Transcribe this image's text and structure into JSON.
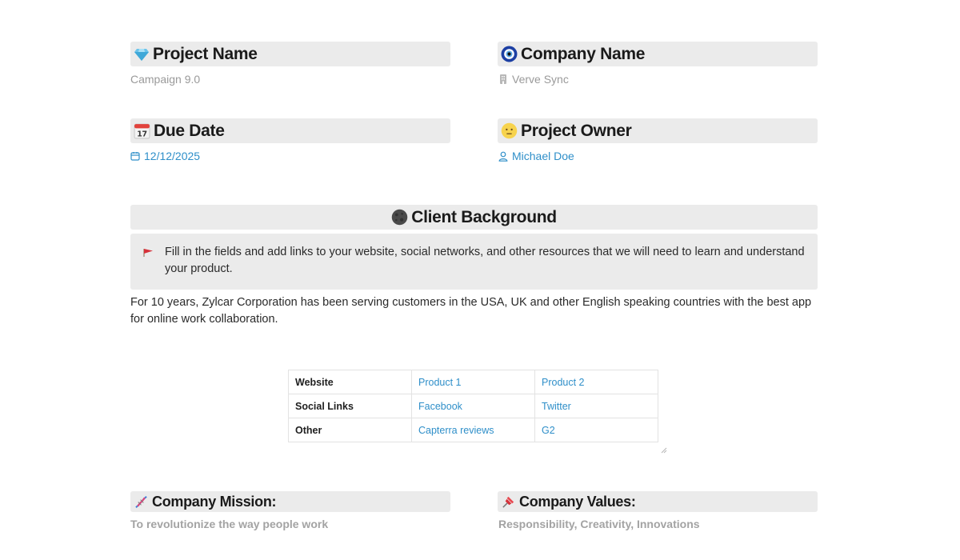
{
  "project": {
    "icon": "gem-icon",
    "title": "Project Name",
    "value": "Campaign 9.0"
  },
  "company": {
    "icon": "nazar-amulet-icon",
    "title": "Company Name",
    "value": "Verve Sync",
    "value_icon": "building-icon"
  },
  "due": {
    "icon": "calendar-emoji-icon",
    "title": "Due Date",
    "value": "12/12/2025",
    "value_icon": "calendar-icon"
  },
  "owner": {
    "icon": "smiley-icon",
    "title": "Project Owner",
    "value": "Michael Doe",
    "value_icon": "person-icon"
  },
  "client": {
    "icon": "new-moon-face-icon",
    "title": "Client Background",
    "callout": "Fill in the fields and add links to your website, social networks, and other resources that we will need to learn and understand your product.",
    "paragraph": "For 10 years, Zylcar Corporation has been serving customers in the USA, UK and other English speaking countries with the best app for online work collaboration."
  },
  "table": {
    "rows": [
      {
        "label": "Website",
        "c1": "Product 1",
        "c2": "Product 2"
      },
      {
        "label": "Social Links",
        "c1": "Facebook",
        "c2": "Twitter"
      },
      {
        "label": "Other",
        "c1": "Capterra reviews",
        "c2": "G2"
      }
    ]
  },
  "mission": {
    "icon": "dna-icon",
    "title": "Company Mission:",
    "value": "To revolutionize the way people work"
  },
  "values": {
    "icon": "pushpin-icon",
    "title": "Company Values:",
    "value": "Responsibility, Creativity, Innovations"
  },
  "colors": {
    "accent": "#2f8fc9",
    "heading_bg": "#ebebeb",
    "muted": "#9a9a9a",
    "flag": "#d6313a"
  }
}
